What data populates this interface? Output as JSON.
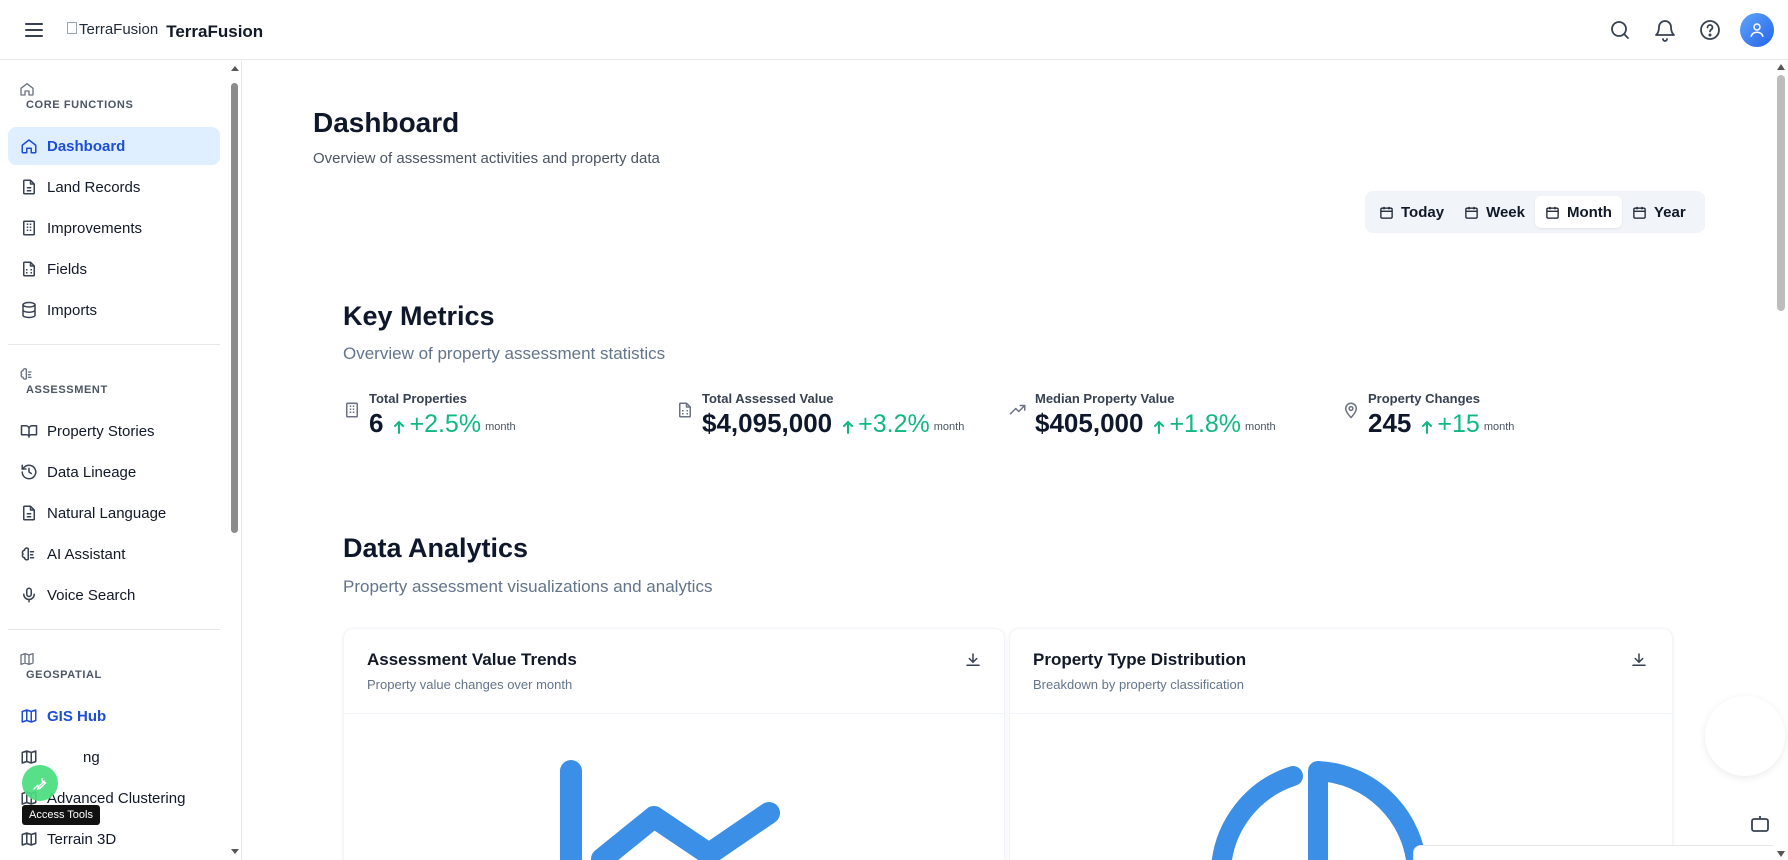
{
  "header": {
    "logo_alt": "TerraFusion",
    "app_name": "TerraFusion",
    "icons": [
      "menu-icon",
      "search-icon",
      "bell-icon",
      "help-icon",
      "user-icon"
    ]
  },
  "sidebar": {
    "sections": [
      {
        "label": "CORE FUNCTIONS",
        "icon": "home-icon",
        "items": [
          {
            "label": "Dashboard",
            "icon": "home-icon",
            "active": true
          },
          {
            "label": "Land Records",
            "icon": "file-text-icon"
          },
          {
            "label": "Improvements",
            "icon": "building-icon"
          },
          {
            "label": "Fields",
            "icon": "file-spreadsheet-icon"
          },
          {
            "label": "Imports",
            "icon": "database-icon"
          }
        ]
      },
      {
        "label": "ASSESSMENT",
        "icon": "brain-icon",
        "items": [
          {
            "label": "Property Stories",
            "icon": "book-open-icon"
          },
          {
            "label": "Data Lineage",
            "icon": "history-icon"
          },
          {
            "label": "Natural Language",
            "icon": "file-text-icon"
          },
          {
            "label": "AI Assistant",
            "icon": "brain-icon"
          },
          {
            "label": "Voice Search",
            "icon": "mic-icon"
          }
        ]
      },
      {
        "label": "GEOSPATIAL",
        "icon": "map-icon",
        "items": [
          {
            "label": "GIS Hub",
            "icon": "map-icon"
          },
          {
            "label": "ng",
            "icon": "map-icon"
          },
          {
            "label": "Advanced Clustering",
            "icon": "map-icon"
          },
          {
            "label": "Terrain 3D",
            "icon": "map-icon"
          }
        ]
      }
    ],
    "tooltip": "Access Tools"
  },
  "main": {
    "title": "Dashboard",
    "subtitle": "Overview of assessment activities and property data",
    "ranges": [
      {
        "label": "Today",
        "active": false
      },
      {
        "label": "Week",
        "active": false
      },
      {
        "label": "Month",
        "active": true
      },
      {
        "label": "Year",
        "active": false
      }
    ],
    "key_metrics": {
      "title": "Key Metrics",
      "subtitle": "Overview of property assessment statistics",
      "items": [
        {
          "label": "Total Properties",
          "value": "6",
          "change": "+2.5%",
          "period": "month",
          "icon": "building-icon"
        },
        {
          "label": "Total Assessed Value",
          "value": "$4,095,000",
          "change": "+3.2%",
          "period": "month",
          "icon": "file-spreadsheet-icon"
        },
        {
          "label": "Median Property Value",
          "value": "$405,000",
          "change": "+1.8%",
          "period": "month",
          "icon": "trending-up-icon"
        },
        {
          "label": "Property Changes",
          "value": "245",
          "change": "+15",
          "period": "month",
          "icon": "map-pin-icon"
        }
      ]
    },
    "analytics": {
      "title": "Data Analytics",
      "subtitle": "Property assessment visualizations and analytics",
      "cards": [
        {
          "title": "Assessment Value Trends",
          "subtitle": "Property value changes over month"
        },
        {
          "title": "Property Type Distribution",
          "subtitle": "Breakdown by property classification"
        }
      ]
    }
  },
  "colors": {
    "accent": "#1d4ed8",
    "active_bg": "#e0efff",
    "positive": "#10b981",
    "chart": "#3b8fe6"
  }
}
